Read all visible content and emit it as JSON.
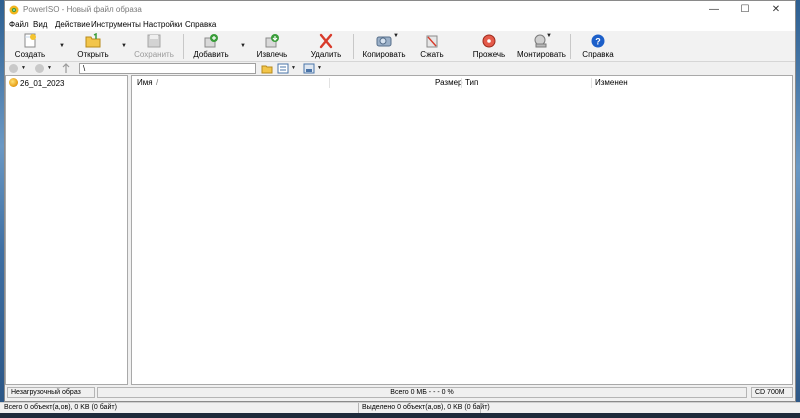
{
  "window": {
    "title": "PowerISO - Новый файл образа",
    "minimize": "—",
    "maximize": "☐",
    "close": "✕"
  },
  "menu": [
    "Файл",
    "Вид",
    "Действие",
    "Инструменты",
    "Настройки",
    "Справка"
  ],
  "toolbar": {
    "create": "Создать",
    "open": "Открыть",
    "save": "Сохранить",
    "add": "Добавить",
    "extract": "Извлечь",
    "delete": "Удалить",
    "copy": "Копировать",
    "compress": "Сжать",
    "burn": "Прожечь",
    "mount": "Монтировать",
    "help": "Справка"
  },
  "address": {
    "path": "\\"
  },
  "tree": {
    "root": "26_01_2023"
  },
  "list": {
    "columns": [
      "Имя",
      "Размер",
      "Тип",
      "Изменен"
    ],
    "sort_indicator": "/"
  },
  "status": {
    "boot": "Незагрузочный образ",
    "total": "Всего  0 MБ   - - -  0 %",
    "media": "CD 700M",
    "total_objects": "Всего 0 объект(а,ов), 0 KB (0 байт)",
    "selected_objects": "Выделено 0 объект(а,ов), 0 KB (0 байт)"
  },
  "colors": {
    "accent_green": "#3a9d3a",
    "delete_red": "#d83a2a",
    "help_blue": "#1c5fc9"
  }
}
